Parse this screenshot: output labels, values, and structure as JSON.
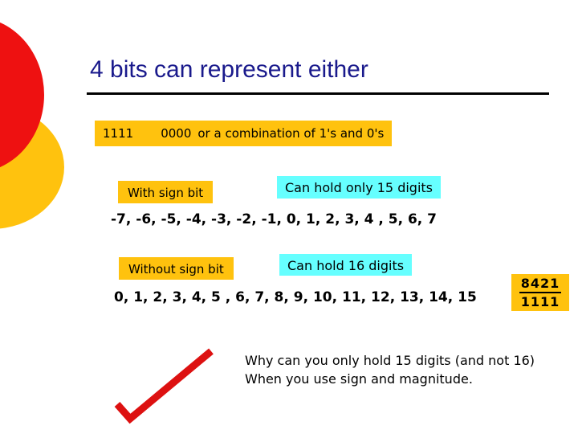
{
  "slide": {
    "title": "4 bits can represent either",
    "title_color": "#1A1A8C",
    "background_color": "#ffffff"
  },
  "decor": {
    "red_circle_color": "#EE1111",
    "yellow_circle_color": "#FFC20E",
    "check_mark_color": "#DD1111"
  },
  "highlight_colors": {
    "yellow": "#FFC20E",
    "cyan": "#66FFFF"
  },
  "bits_row": {
    "left_value": "1111",
    "right_value": "0000",
    "note": "or a combination of 1's and 0's"
  },
  "signed_row": {
    "label": "With sign bit",
    "capacity": "Can hold only 15 digits",
    "range": "-7, -6, -5, -4, -3, -2, -1, 0, 1, 2, 3, 4 , 5, 6, 7"
  },
  "unsigned_row": {
    "label": "Without sign bit",
    "capacity": "Can hold 16 digits",
    "range": "0, 1, 2, 3, 4, 5 , 6, 7, 8, 9, 10, 11, 12, 13, 14, 15"
  },
  "place_value_box": {
    "weights": "8421",
    "bits": "1111"
  },
  "question": "Why can you only hold 15 digits (and not 16) When you use sign and magnitude."
}
